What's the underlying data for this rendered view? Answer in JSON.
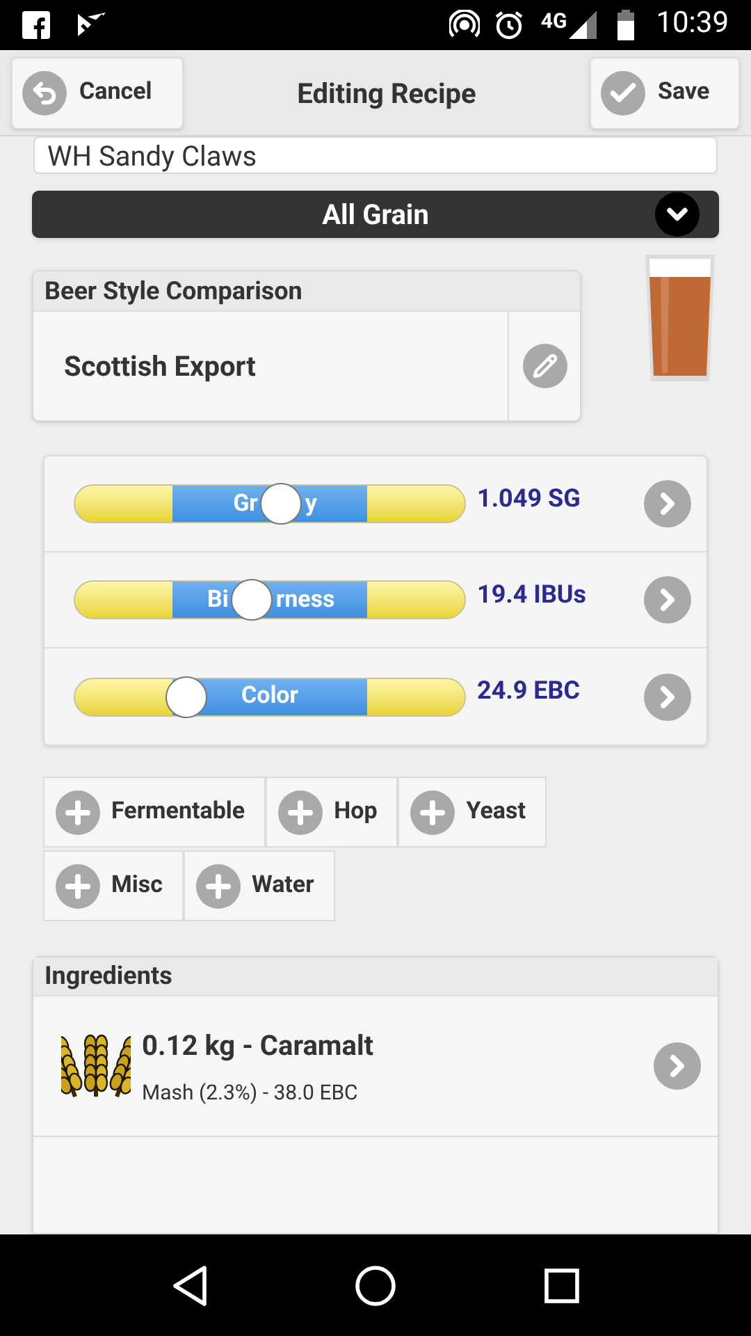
{
  "status_bar": {
    "network": "4G",
    "time": "10:39"
  },
  "header": {
    "cancel": "Cancel",
    "title": "Editing Recipe",
    "save": "Save"
  },
  "recipe_name": {
    "value": "WH Sandy Claws"
  },
  "type_select": {
    "value": "All Grain"
  },
  "style_comparison": {
    "title": "Beer Style Comparison",
    "style": "Scottish Export"
  },
  "stats": [
    {
      "label_parts": [
        "Gr",
        "y"
      ],
      "level": 0.53,
      "reading": "1.049 SG"
    },
    {
      "label_parts": [
        "Bi",
        "rness"
      ],
      "level": 0.455,
      "reading": "19.4 IBUs"
    },
    {
      "label_parts": [
        "Color"
      ],
      "level": 0.285,
      "reading": "24.9 EBC"
    }
  ],
  "add_button_rows": [
    {
      "buttons": [
        "Fermentable",
        "Hop",
        "Yeast"
      ]
    },
    {
      "buttons": [
        "Misc",
        "Water"
      ]
    }
  ],
  "ingredients": {
    "title": "Ingredients",
    "items": [
      {
        "name": "0.12 kg - Caramalt",
        "detail": "Mash (2.3%) - 38.0 EBC"
      }
    ]
  }
}
